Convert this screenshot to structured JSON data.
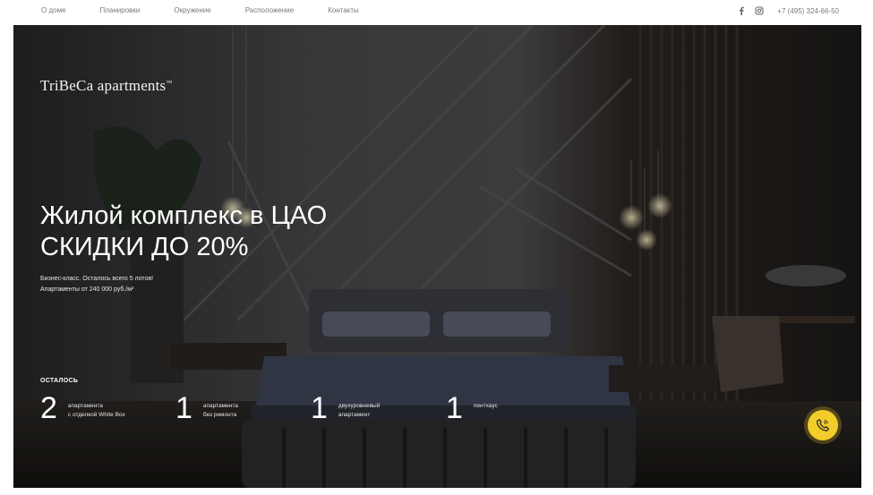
{
  "nav": {
    "items": [
      "О доме",
      "Планировки",
      "Окружение",
      "Расположение",
      "Контакты"
    ],
    "phone": "+7 (495) 324-66-50",
    "socials": [
      "facebook-icon",
      "instagram-icon"
    ]
  },
  "hero": {
    "logo": "TriBeCa apartments",
    "logo_mark": "™",
    "headline_line1": "Жилой комплекс в ЦАО",
    "headline_line2": "СКИДКИ ДО 20%",
    "sub_line1": "Бизнес-класс. Осталось всего 5 лотов!",
    "sub_line2": "Апартаменты от 240 000 руб./м²",
    "remain_label": "ОСТАЛОСЬ",
    "stats": [
      {
        "number": "2",
        "line1": "апартамента",
        "line2": "с отделкой White Box"
      },
      {
        "number": "1",
        "line1": "апартамента",
        "line2": "без ремонта"
      },
      {
        "number": "1",
        "line1": "двухуровневый",
        "line2": "апартамент"
      },
      {
        "number": "1",
        "line1": "пентхаус",
        "line2": ""
      }
    ]
  },
  "colors": {
    "accent": "#f2cd2a",
    "nav_text": "#7a7a7a"
  },
  "call_button_icon": "phone-icon"
}
